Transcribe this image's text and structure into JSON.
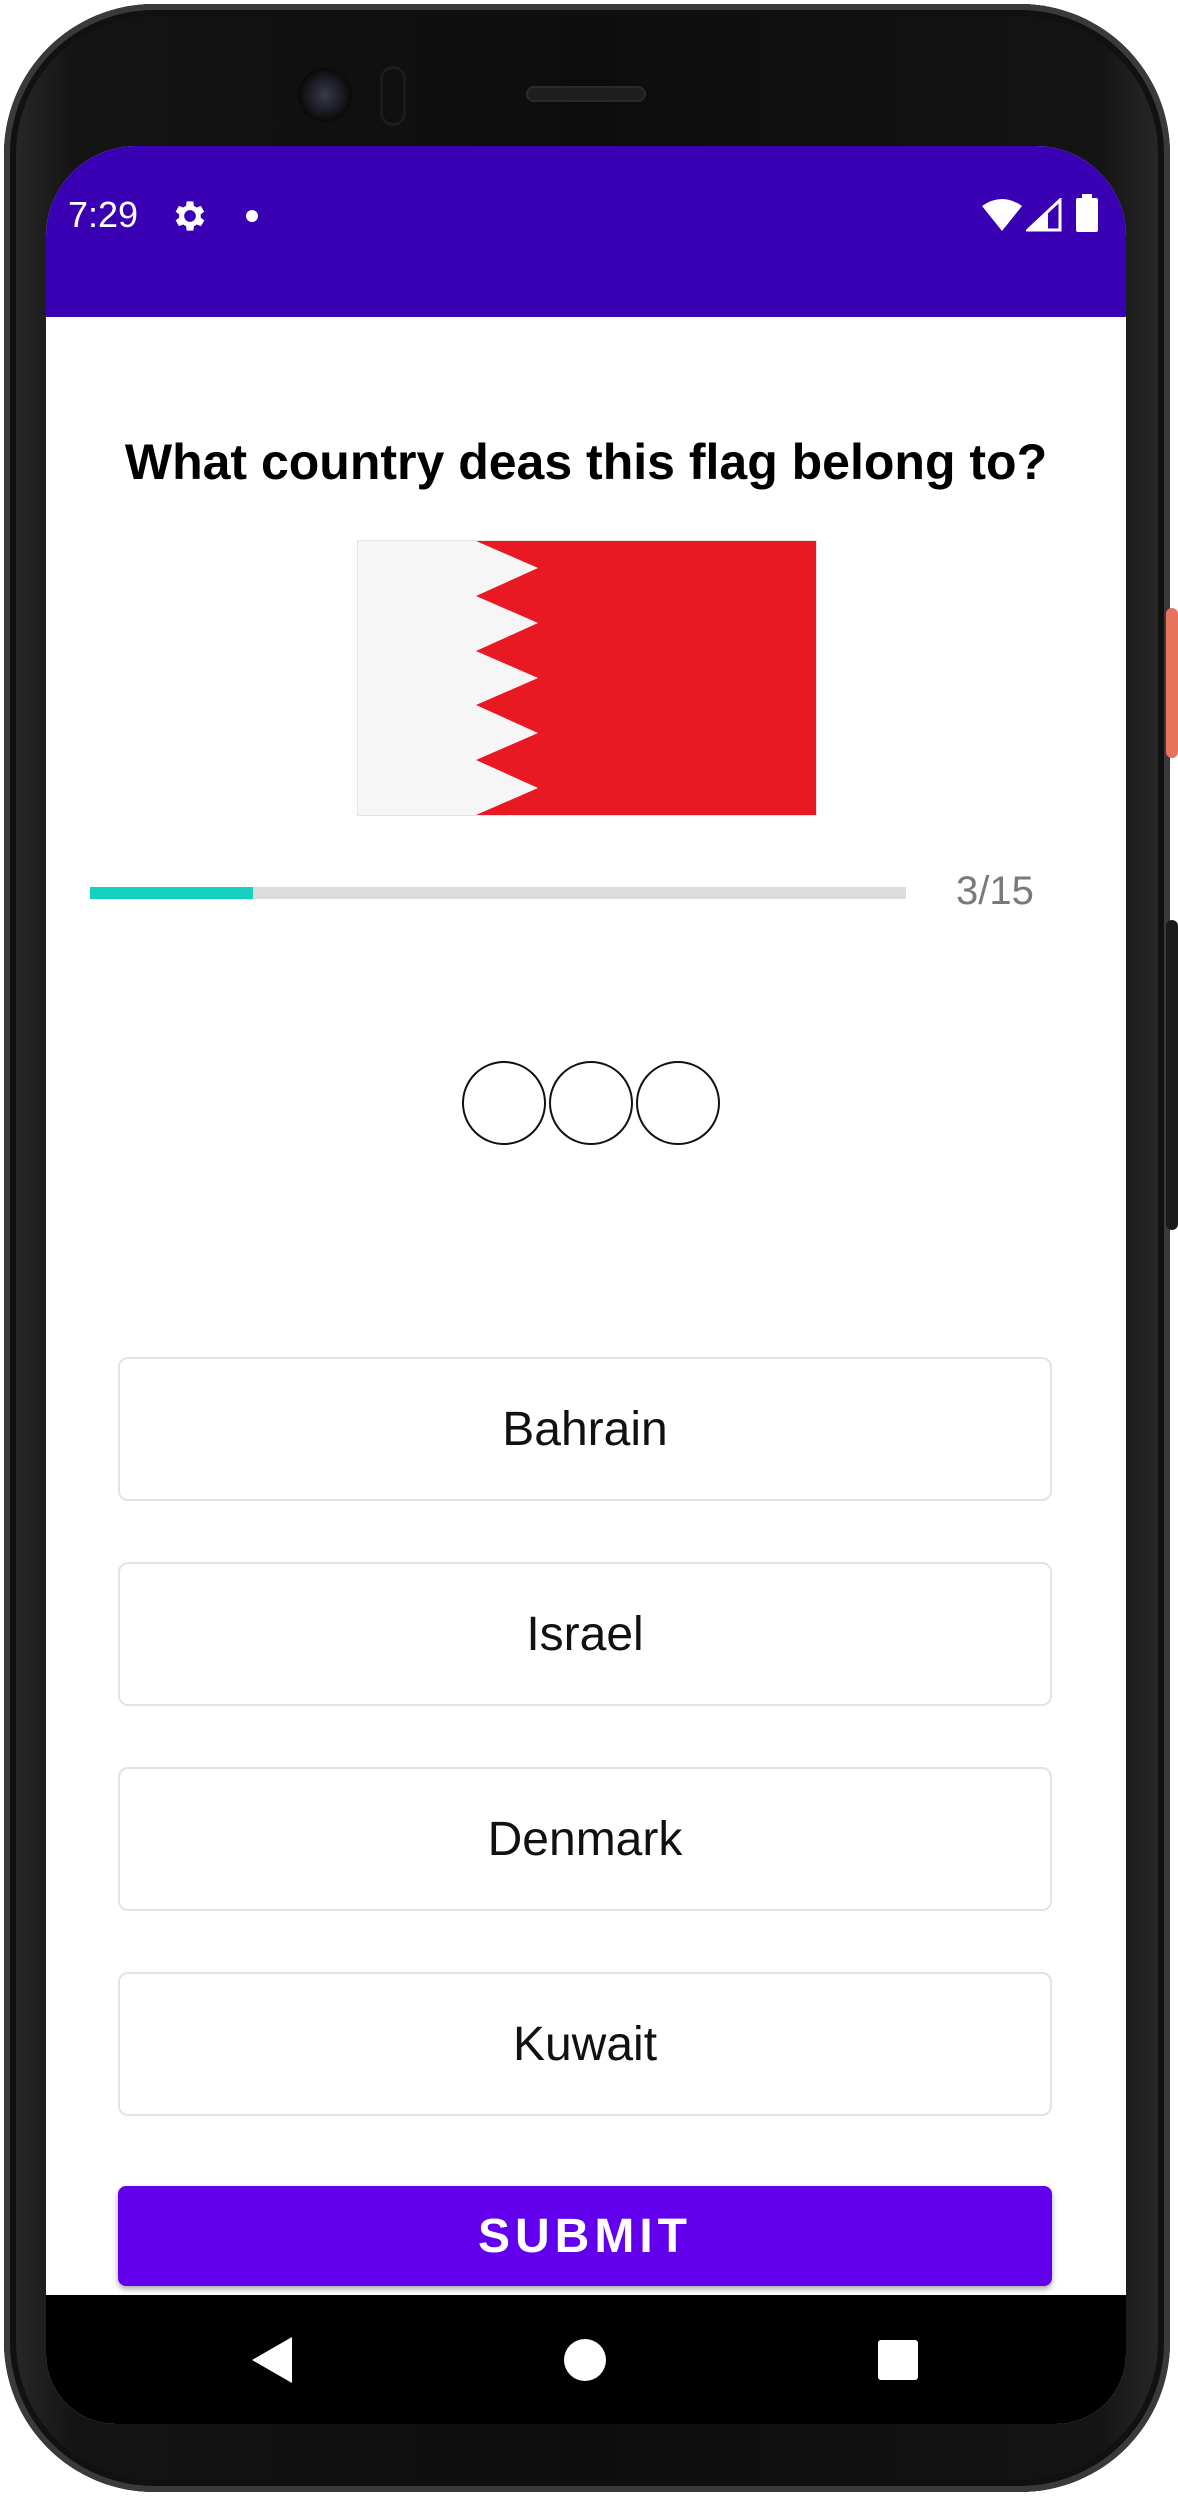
{
  "status_bar": {
    "time": "7:29",
    "icons": [
      "gear-icon",
      "notification-dot-icon",
      "wifi-icon",
      "cell-signal-icon",
      "battery-icon"
    ],
    "background": "#3a00b4"
  },
  "quiz": {
    "question": "What country deas this flag belong to?",
    "flag": {
      "country_depicted": "Bahrain",
      "colors": {
        "hoist": "#f6f6f6",
        "field": "#e81922"
      }
    },
    "progress": {
      "current": 3,
      "total": 15,
      "fraction": 0.2,
      "label": "3/15",
      "fill_color": "#17d1c0"
    },
    "lives": [
      {
        "icon": "empty-circle-icon"
      },
      {
        "icon": "empty-circle-icon"
      },
      {
        "icon": "empty-circle-icon"
      }
    ],
    "options": [
      {
        "label": "Bahrain"
      },
      {
        "label": "Israel"
      },
      {
        "label": "Denmark"
      },
      {
        "label": "Kuwait"
      }
    ],
    "submit_label": "SUBMIT",
    "accent": "#6200ee"
  },
  "nav_bar": {
    "icons": [
      "back-icon",
      "home-icon",
      "recent-apps-icon"
    ]
  }
}
